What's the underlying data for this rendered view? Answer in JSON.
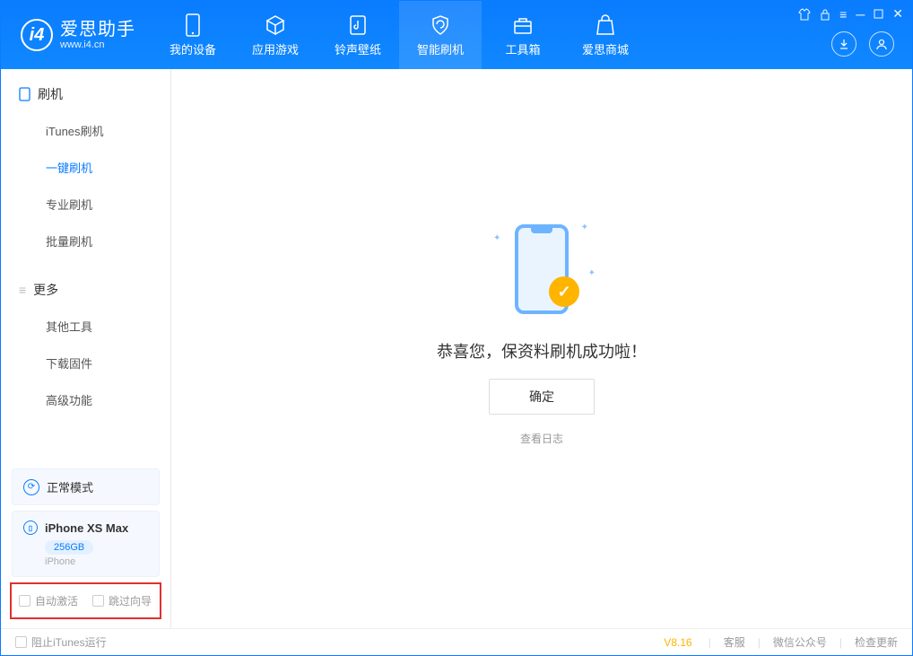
{
  "app": {
    "name": "爱思助手",
    "url": "www.i4.cn"
  },
  "nav": {
    "items": [
      {
        "label": "我的设备"
      },
      {
        "label": "应用游戏"
      },
      {
        "label": "铃声壁纸"
      },
      {
        "label": "智能刷机"
      },
      {
        "label": "工具箱"
      },
      {
        "label": "爱思商城"
      }
    ]
  },
  "sidebar": {
    "section1": {
      "title": "刷机",
      "items": [
        {
          "label": "iTunes刷机"
        },
        {
          "label": "一键刷机"
        },
        {
          "label": "专业刷机"
        },
        {
          "label": "批量刷机"
        }
      ]
    },
    "section2": {
      "title": "更多",
      "items": [
        {
          "label": "其他工具"
        },
        {
          "label": "下载固件"
        },
        {
          "label": "高级功能"
        }
      ]
    },
    "mode": "正常模式",
    "device": {
      "name": "iPhone XS Max",
      "storage": "256GB",
      "type": "iPhone"
    },
    "options": {
      "auto_activate": "自动激活",
      "skip_guide": "跳过向导"
    }
  },
  "main": {
    "success_msg": "恭喜您，保资料刷机成功啦！",
    "ok": "确定",
    "view_log": "查看日志"
  },
  "footer": {
    "block_itunes": "阻止iTunes运行",
    "version": "V8.16",
    "support": "客服",
    "wechat": "微信公众号",
    "update": "检查更新"
  }
}
